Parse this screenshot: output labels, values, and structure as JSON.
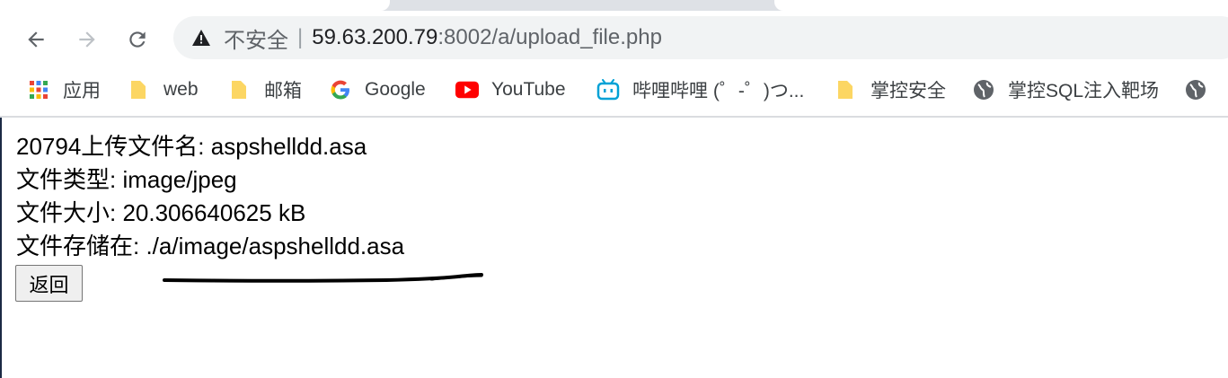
{
  "browser": {
    "address": {
      "security_label": "不安全",
      "separator": "|",
      "host": "59.63.200.79",
      "path": ":8002/a/upload_file.php"
    },
    "bookmarks": [
      {
        "label": "应用",
        "icon": "apps-grid-icon"
      },
      {
        "label": "web",
        "icon": "folder-icon"
      },
      {
        "label": "邮箱",
        "icon": "folder-icon"
      },
      {
        "label": "Google",
        "icon": "google-icon"
      },
      {
        "label": "YouTube",
        "icon": "youtube-icon"
      },
      {
        "label": "哔哩哔哩 (゜-゜)つ...",
        "icon": "bilibili-icon"
      },
      {
        "label": "掌控安全",
        "icon": "folder-icon"
      },
      {
        "label": "掌控SQL注入靶场",
        "icon": "globe-icon"
      }
    ]
  },
  "page": {
    "lines": [
      "20794上传文件名: aspshelldd.asa",
      "文件类型: image/jpeg",
      "文件大小: 20.306640625 kB",
      "文件存储在: ./a/image/aspshelldd.asa"
    ],
    "back_button": "返回"
  },
  "colors": {
    "omnibox_bg": "#f1f3f4",
    "tabstrip_bg": "#dee1e6",
    "folder_yellow": "#fcd663",
    "youtube_red": "#ff0000",
    "bilibili_blue": "#00a1d6"
  }
}
